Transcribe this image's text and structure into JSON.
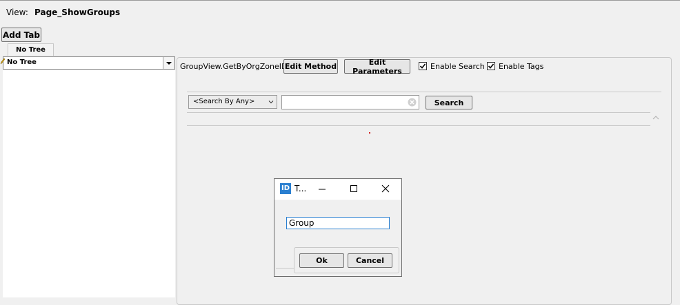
{
  "view": {
    "label": "View:",
    "name": "Page_ShowGroups"
  },
  "toolbar": {
    "add_tab": "Add Tab"
  },
  "tree_tab": {
    "label": "No Tree"
  },
  "tree_select": {
    "value": "No Tree"
  },
  "method": {
    "name": "GroupView.GetByOrgZoneID",
    "edit_method": "Edit Method",
    "edit_parameters": "Edit Parameters"
  },
  "options": {
    "enable_search": "Enable Search",
    "enable_tags": "Enable Tags"
  },
  "search": {
    "by": "<Search By Any>",
    "button": "Search",
    "value": ""
  },
  "dialog": {
    "icon_text": "ID",
    "title": "T...",
    "input_value": "Group",
    "ok": "Ok",
    "cancel": "Cancel"
  }
}
